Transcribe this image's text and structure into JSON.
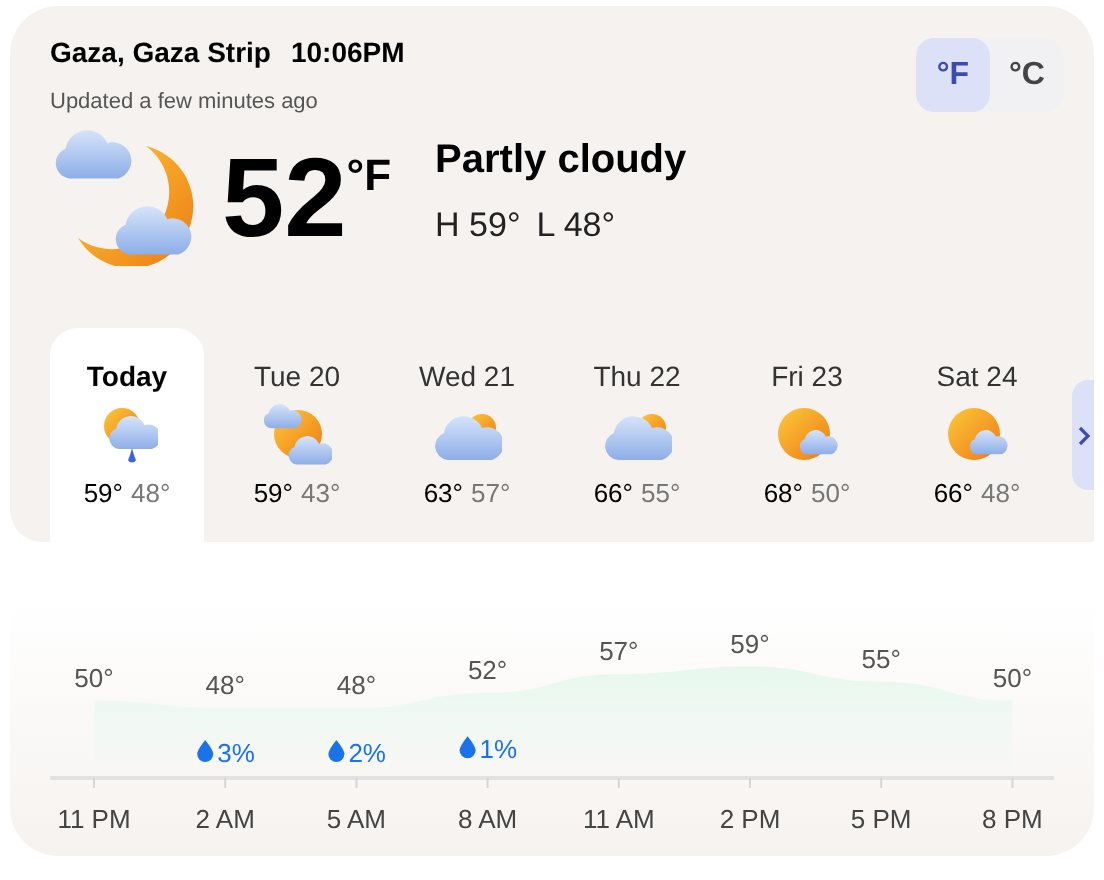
{
  "location": {
    "place": "Gaza, Gaza Strip",
    "time": "10:06PM",
    "updated": "Updated a few minutes ago"
  },
  "units": [
    {
      "label": "°F",
      "selected": true
    },
    {
      "label": "°C",
      "selected": false
    }
  ],
  "current": {
    "kind": "night-partly-cloudy",
    "temperature": "52",
    "unit": "°F",
    "condition": "Partly cloudy",
    "high": "H 59°",
    "low": "L 48°"
  },
  "days": [
    {
      "label": "Today",
      "selected": true,
      "kind": "rain",
      "high": "59°",
      "low": "48°"
    },
    {
      "label": "Tue 20",
      "selected": false,
      "kind": "sun-clouds",
      "high": "59°",
      "low": "43°"
    },
    {
      "label": "Wed 21",
      "selected": false,
      "kind": "cloudy",
      "high": "63°",
      "low": "57°"
    },
    {
      "label": "Thu 22",
      "selected": false,
      "kind": "cloudy",
      "high": "66°",
      "low": "55°"
    },
    {
      "label": "Fri 23",
      "selected": false,
      "kind": "sunny",
      "high": "68°",
      "low": "50°"
    },
    {
      "label": "Sat 24",
      "selected": false,
      "kind": "sunny",
      "high": "66°",
      "low": "48°"
    }
  ],
  "hourly": {
    "chart_data": {
      "type": "area",
      "categories": [
        "11 PM",
        "2 AM",
        "5 AM",
        "8 AM",
        "11 AM",
        "2 PM",
        "5 PM",
        "8 PM"
      ],
      "series": [
        {
          "color": "#e6f8ee",
          "values": [
            50,
            48,
            48,
            52,
            57,
            59,
            55,
            50
          ],
          "value_labels": [
            "50°",
            "48°",
            "48°",
            "52°",
            "57°",
            "59°",
            "55°",
            "50°"
          ]
        }
      ],
      "annotations": [
        {
          "x": "2 AM",
          "y": 48,
          "text": "3%"
        },
        {
          "x": "5 AM",
          "y": 48,
          "text": "2%"
        },
        {
          "x": "8 AM",
          "y": 52,
          "text": "1%"
        }
      ]
    }
  }
}
